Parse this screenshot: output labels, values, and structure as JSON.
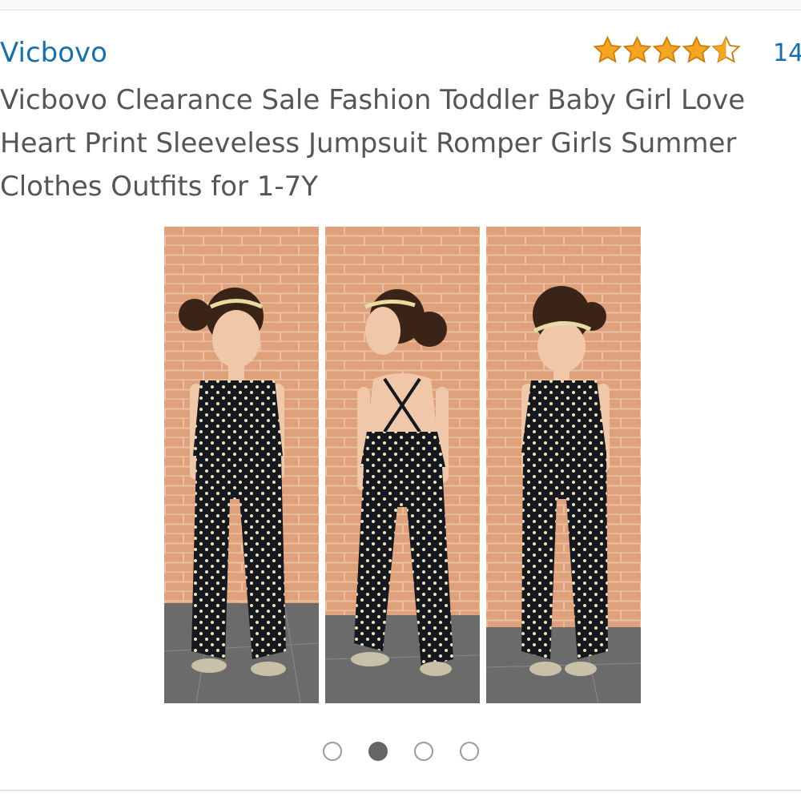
{
  "product": {
    "brand": "Vicbovo",
    "title": "Vicbovo Clearance Sale Fashion Toddler Baby Girl Love Heart Print Sleeveless Jumpsuit Romper Girls Summer Clothes Outfits for 1-7Y",
    "rating": 4.5,
    "rating_max": 5,
    "review_count": "14"
  },
  "gallery": {
    "image_count": 4,
    "active_index": 1,
    "panels": [
      {
        "view": "front"
      },
      {
        "view": "back"
      },
      {
        "view": "front-looking-down"
      }
    ]
  },
  "colors": {
    "brand_link": "#1a6fa8",
    "title_text": "#565656",
    "star": "#f4a623",
    "star_outline": "#c77f10",
    "dot_active": "#666666",
    "dot_inactive": "#9a9a9a"
  },
  "icons": {
    "star": "star-icon",
    "pager_dot": "carousel-dot-icon"
  }
}
